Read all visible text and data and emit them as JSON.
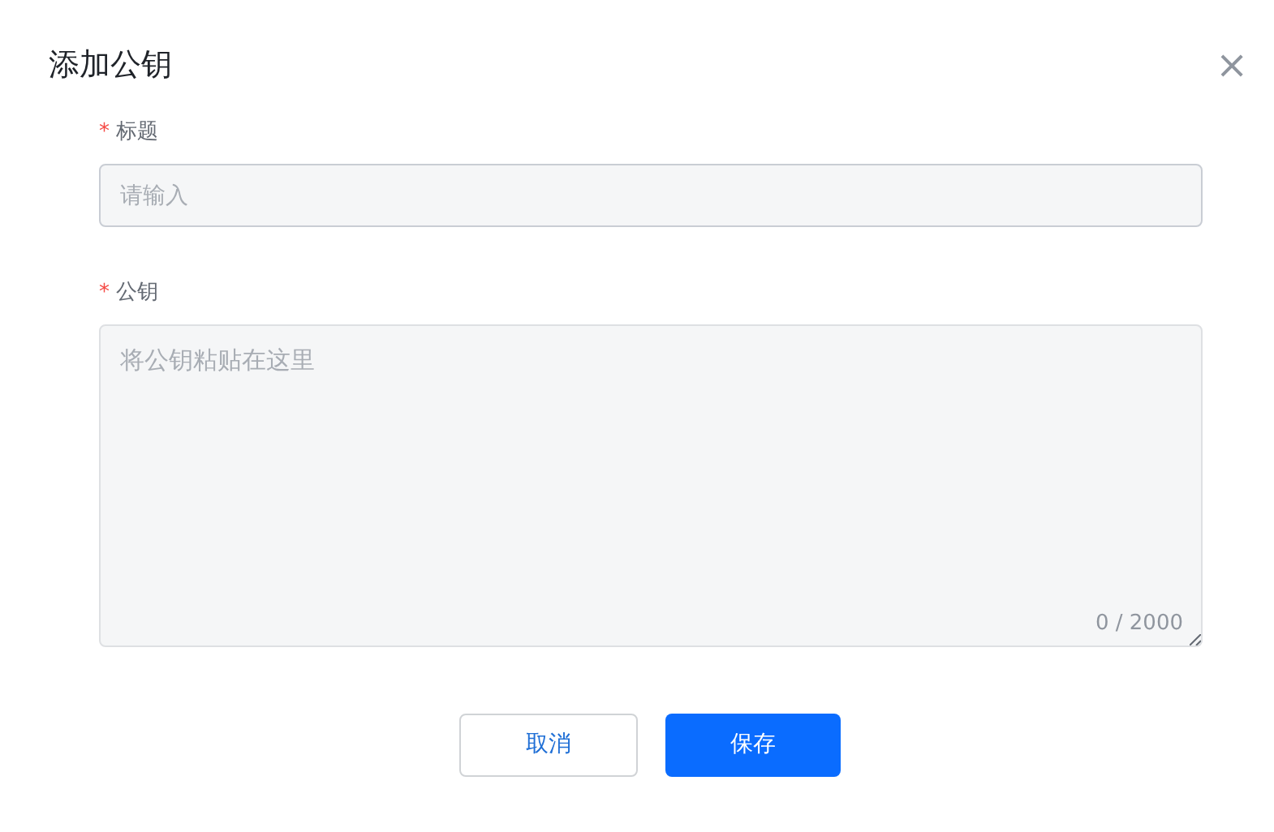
{
  "dialog": {
    "title": "添加公钥",
    "close_icon": "×"
  },
  "fields": [
    {
      "kind": "input",
      "label": "标题",
      "required_mark": "*",
      "placeholder": "请输入"
    },
    {
      "kind": "textarea",
      "label": "公钥",
      "required_mark": "*",
      "placeholder": "将公钥粘贴在这里",
      "counter": "0 / 2000"
    }
  ],
  "buttons": [
    {
      "kind": "secondary",
      "label": "取消"
    },
    {
      "kind": "primary",
      "label": "保存"
    }
  ]
}
